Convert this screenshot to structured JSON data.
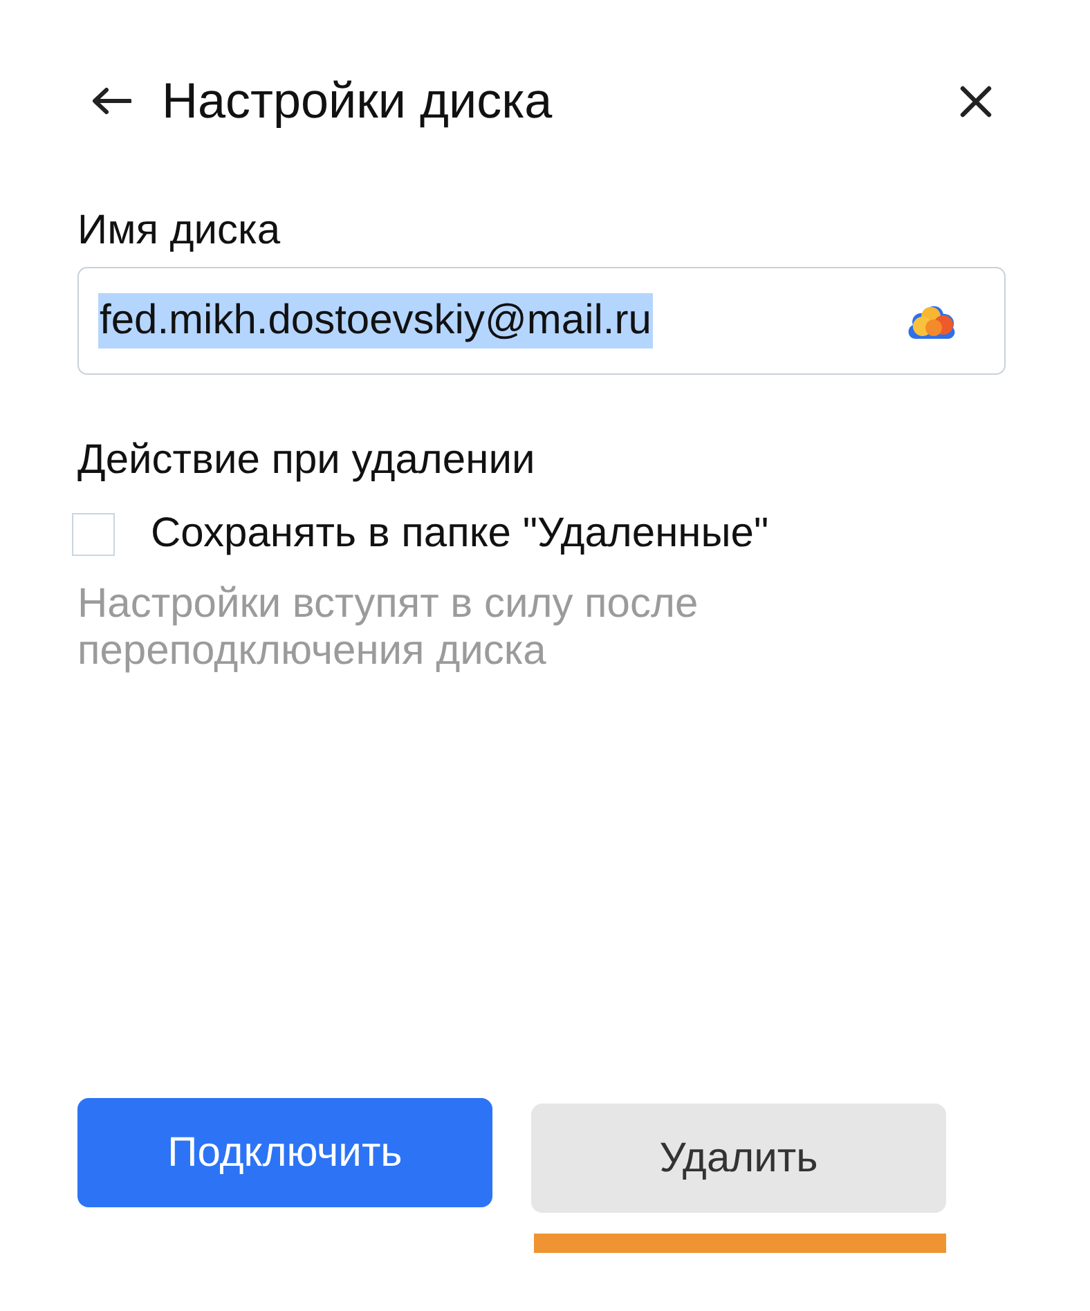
{
  "header": {
    "title": "Настройки диска"
  },
  "disk_name": {
    "label": "Имя диска",
    "value": "fed.mikh.dostoevskiy@mail.ru",
    "text_selected": true
  },
  "delete_action": {
    "heading": "Действие при удалении",
    "option": {
      "label": "Сохранять в папке \"Удаленные\"",
      "checked": false
    },
    "hint": "Настройки вступят в силу после переподключения диска"
  },
  "buttons": [
    {
      "label": "Подключить",
      "kind": "primary",
      "highlighted": false
    },
    {
      "label": "Удалить",
      "kind": "secondary",
      "highlighted": true
    }
  ]
}
